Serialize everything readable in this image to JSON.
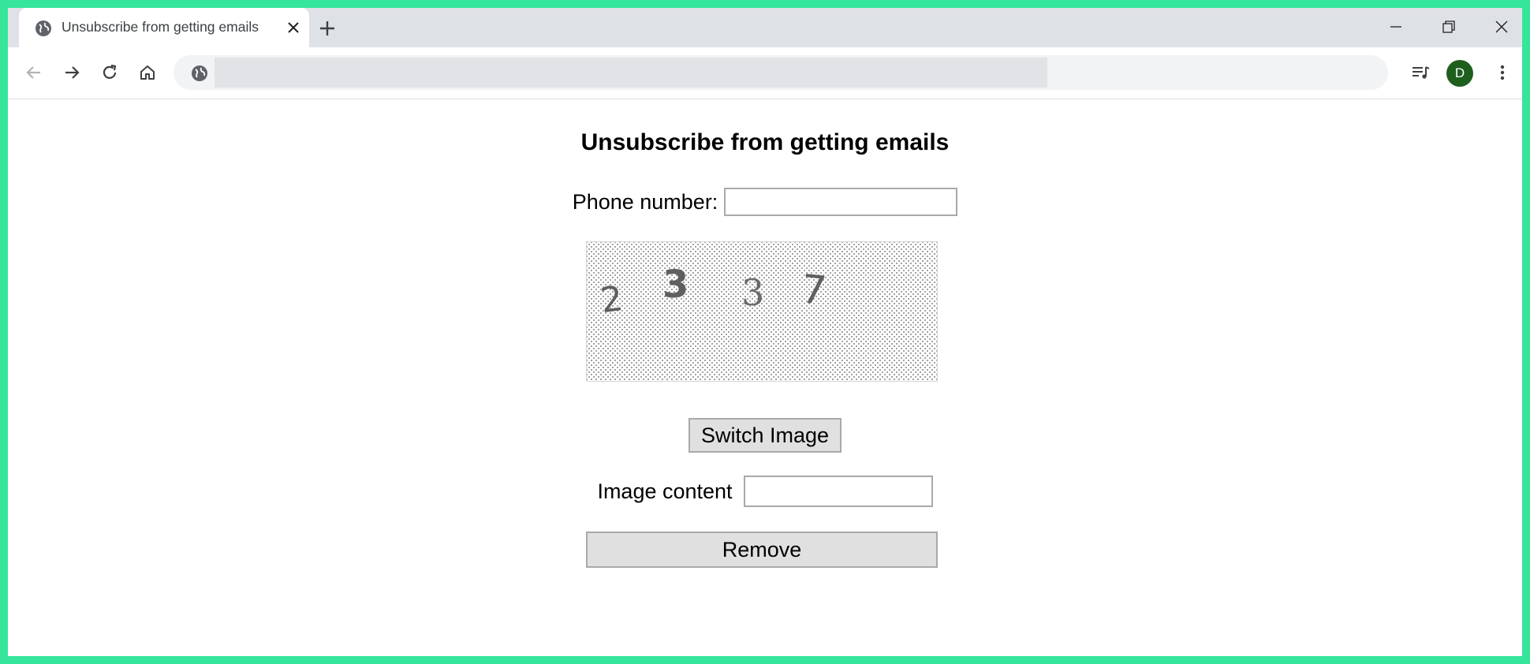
{
  "browser": {
    "tab_title": "Unsubscribe from getting emails",
    "avatar_letter": "D"
  },
  "page": {
    "title": "Unsubscribe from getting emails",
    "phone_label": "Phone number:",
    "phone_value": "",
    "captcha_digits": [
      "2",
      "3",
      "3",
      "7"
    ],
    "switch_button": "Switch Image",
    "image_content_label": "Image content",
    "image_content_value": "",
    "remove_button": "Remove"
  },
  "colors": {
    "frame": "#35e59a",
    "tabstrip": "#dee1e6",
    "avatar": "#1e5f1e",
    "button_bg": "#e0e0e0"
  }
}
